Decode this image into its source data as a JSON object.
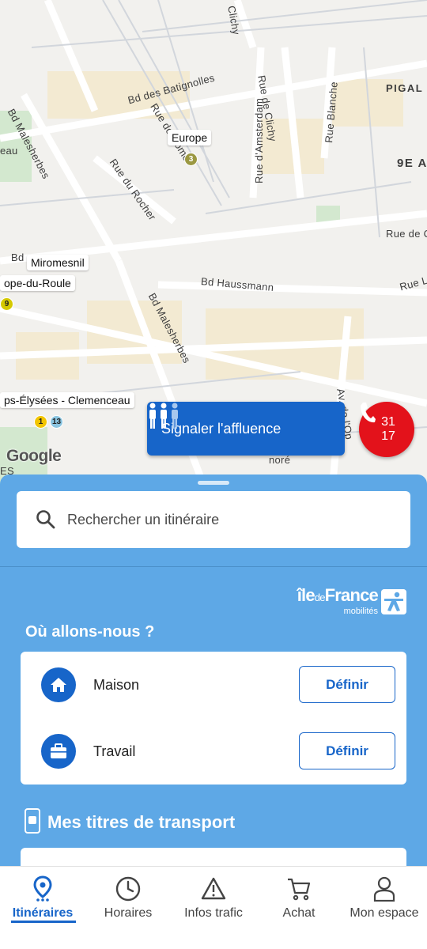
{
  "map": {
    "streets": {
      "clichy_top": "Clichy",
      "batignolles": "Bd des Batignolles",
      "pigalle": "PIGAL",
      "malesherbes_top": "Bd Malesherbes",
      "rue_de_rome": "Rue de Rome",
      "amsterdam": "Rue d'Amsterdam",
      "rue_clichy": "Rue de Clichy",
      "rue_blanche": "Rue Blanche",
      "arr_9e": "9E A",
      "eau": "eau",
      "rue_du_rocher": "Rue du Rocher",
      "rue_de_c": "Rue de C",
      "rue_la": "Rue La",
      "bd_haussmann": "Bd Haussmann",
      "bd_malesherbes": "Bd Malesherbes",
      "bd_left": "Bd",
      "av_de_opera": "Av. de l'Op",
      "hore": "noré",
      "es": "ES"
    },
    "stations": {
      "europe": "Europe",
      "miromesnil": "Miromesnil",
      "philippe": "ope-du-Roule",
      "clemenceau": "ps-Élysées - Clemenceau"
    },
    "badges": {
      "europe_line": "3",
      "philippe_line": "9",
      "clemenceau_line1": "1",
      "clemenceau_line2": "13"
    },
    "attribution": "Google",
    "affluence_button": "Signaler l'affluence",
    "emergency_line1": "31",
    "emergency_line2": "17"
  },
  "panel": {
    "search_placeholder": "Rechercher un itinéraire",
    "logo_brand_a": "île",
    "logo_brand_de": "de",
    "logo_brand_b": "France",
    "logo_sub": "mobilités",
    "section_title": "Où allons-nous ?",
    "places": [
      {
        "label": "Maison",
        "action": "Définir",
        "icon": "home-icon"
      },
      {
        "label": "Travail",
        "action": "Définir",
        "icon": "briefcase-icon"
      }
    ],
    "titres_title": "Mes titres de transport"
  },
  "nav": {
    "items": [
      {
        "label": "Itinéraires",
        "icon": "location-pin-icon",
        "active": true
      },
      {
        "label": "Horaires",
        "icon": "clock-icon",
        "active": false
      },
      {
        "label": "Infos trafic",
        "icon": "warning-icon",
        "active": false
      },
      {
        "label": "Achat",
        "icon": "cart-icon",
        "active": false
      },
      {
        "label": "Mon espace",
        "icon": "user-icon",
        "active": false
      }
    ]
  },
  "colors": {
    "primary": "#1765c9",
    "panel": "#5ea8e6",
    "emergency": "#e3121b",
    "line3": "#9b9842",
    "line1": "#f2c500",
    "line13": "#8bc5e0",
    "line9": "#d5c900"
  }
}
